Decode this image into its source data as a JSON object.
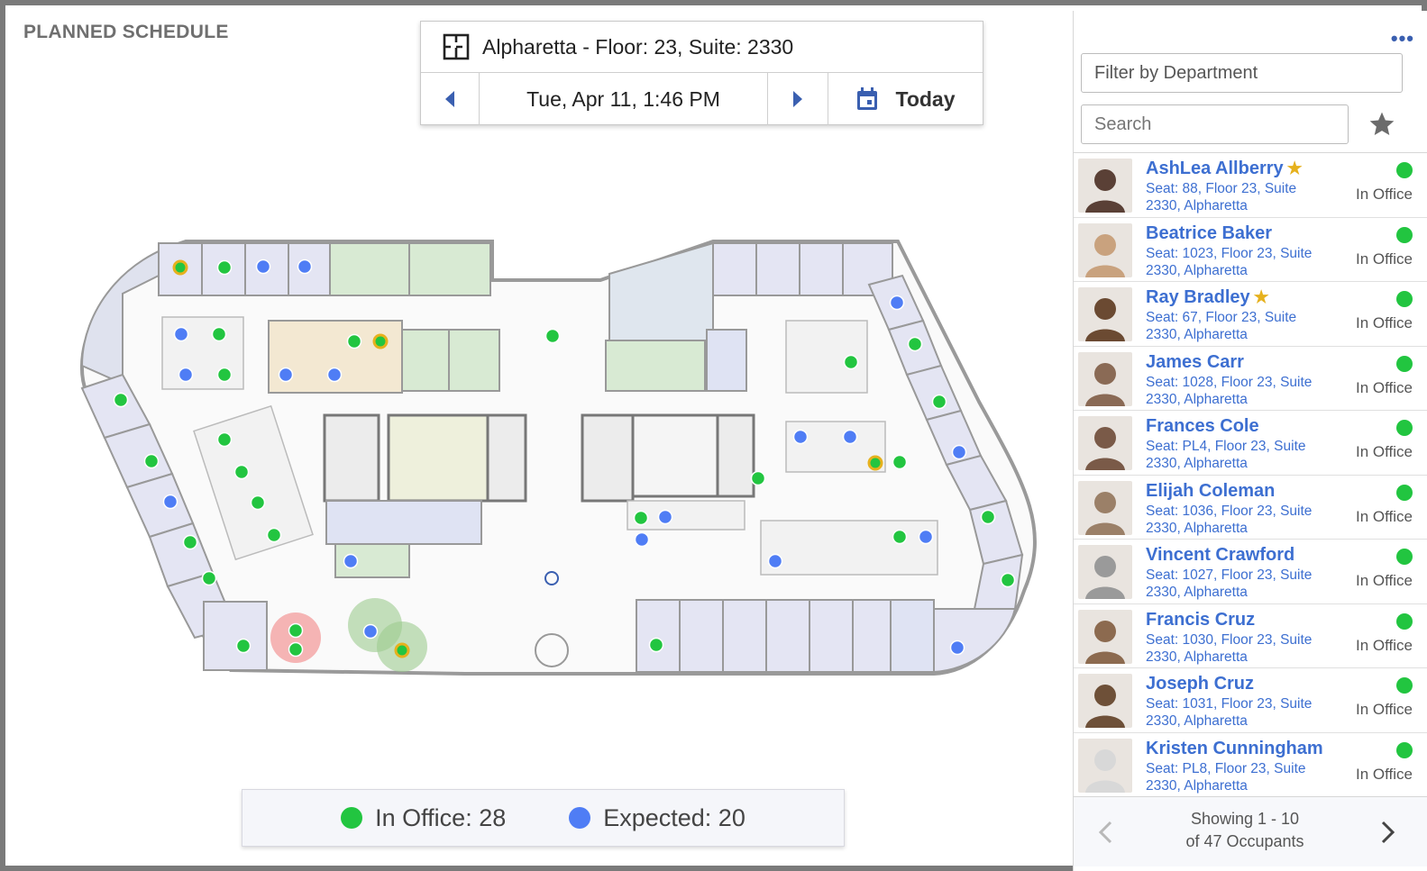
{
  "page": {
    "title": "PLANNED SCHEDULE"
  },
  "location": {
    "name": "Alpharetta - Floor: 23, Suite: 2330",
    "datetime": "Tue, Apr 11, 1:46 PM",
    "today_label": "Today",
    "icons": {
      "floor": "floor-plan-icon",
      "prev": "chevron-left-icon",
      "next": "chevron-right-icon",
      "calendar": "calendar-icon"
    }
  },
  "legend": {
    "in_office": "In Office: 28",
    "expected": "Expected: 20"
  },
  "colors": {
    "in_office": "#22c540",
    "expected": "#4f7df5",
    "highlight_ring": "#e6b11d",
    "accent_blue": "#3d6fd1",
    "meeting_room": "#d8ead3",
    "office_room": "#e4e5f3",
    "kitchen": "#f3e8d2"
  },
  "sidebar": {
    "more_icon": "more-horizontal-icon",
    "department_filter": "Filter by Department",
    "search_placeholder": "Search",
    "favorites_icon": "star-icon",
    "occupants": [
      {
        "name": "AshLea Allberry",
        "favorite": true,
        "seat": "Seat: 88, Floor 23, Suite 2330, Alpharetta",
        "status": "In Office"
      },
      {
        "name": "Beatrice Baker",
        "favorite": false,
        "seat": "Seat: 1023, Floor 23, Suite 2330, Alpharetta",
        "status": "In Office"
      },
      {
        "name": "Ray Bradley",
        "favorite": true,
        "seat": "Seat: 67, Floor 23, Suite 2330, Alpharetta",
        "status": "In Office"
      },
      {
        "name": "James Carr",
        "favorite": false,
        "seat": "Seat: 1028, Floor 23, Suite 2330, Alpharetta",
        "status": "In Office"
      },
      {
        "name": "Frances Cole",
        "favorite": false,
        "seat": "Seat: PL4, Floor 23, Suite 2330, Alpharetta",
        "status": "In Office"
      },
      {
        "name": "Elijah Coleman",
        "favorite": false,
        "seat": "Seat: 1036, Floor 23, Suite 2330, Alpharetta",
        "status": "In Office"
      },
      {
        "name": "Vincent Crawford",
        "favorite": false,
        "seat": "Seat: 1027, Floor 23, Suite 2330, Alpharetta",
        "status": "In Office"
      },
      {
        "name": "Francis Cruz",
        "favorite": false,
        "seat": "Seat: 1030, Floor 23, Suite 2330, Alpharetta",
        "status": "In Office"
      },
      {
        "name": "Joseph Cruz",
        "favorite": false,
        "seat": "Seat: 1031, Floor 23, Suite 2330, Alpharetta",
        "status": "In Office"
      },
      {
        "name": "Kristen Cunningham",
        "favorite": false,
        "seat": "Seat: PL8, Floor 23, Suite 2330, Alpharetta",
        "status": "In Office"
      }
    ],
    "pager": {
      "line1": "Showing 1 - 10",
      "line2": "of 47 Occupants"
    }
  }
}
